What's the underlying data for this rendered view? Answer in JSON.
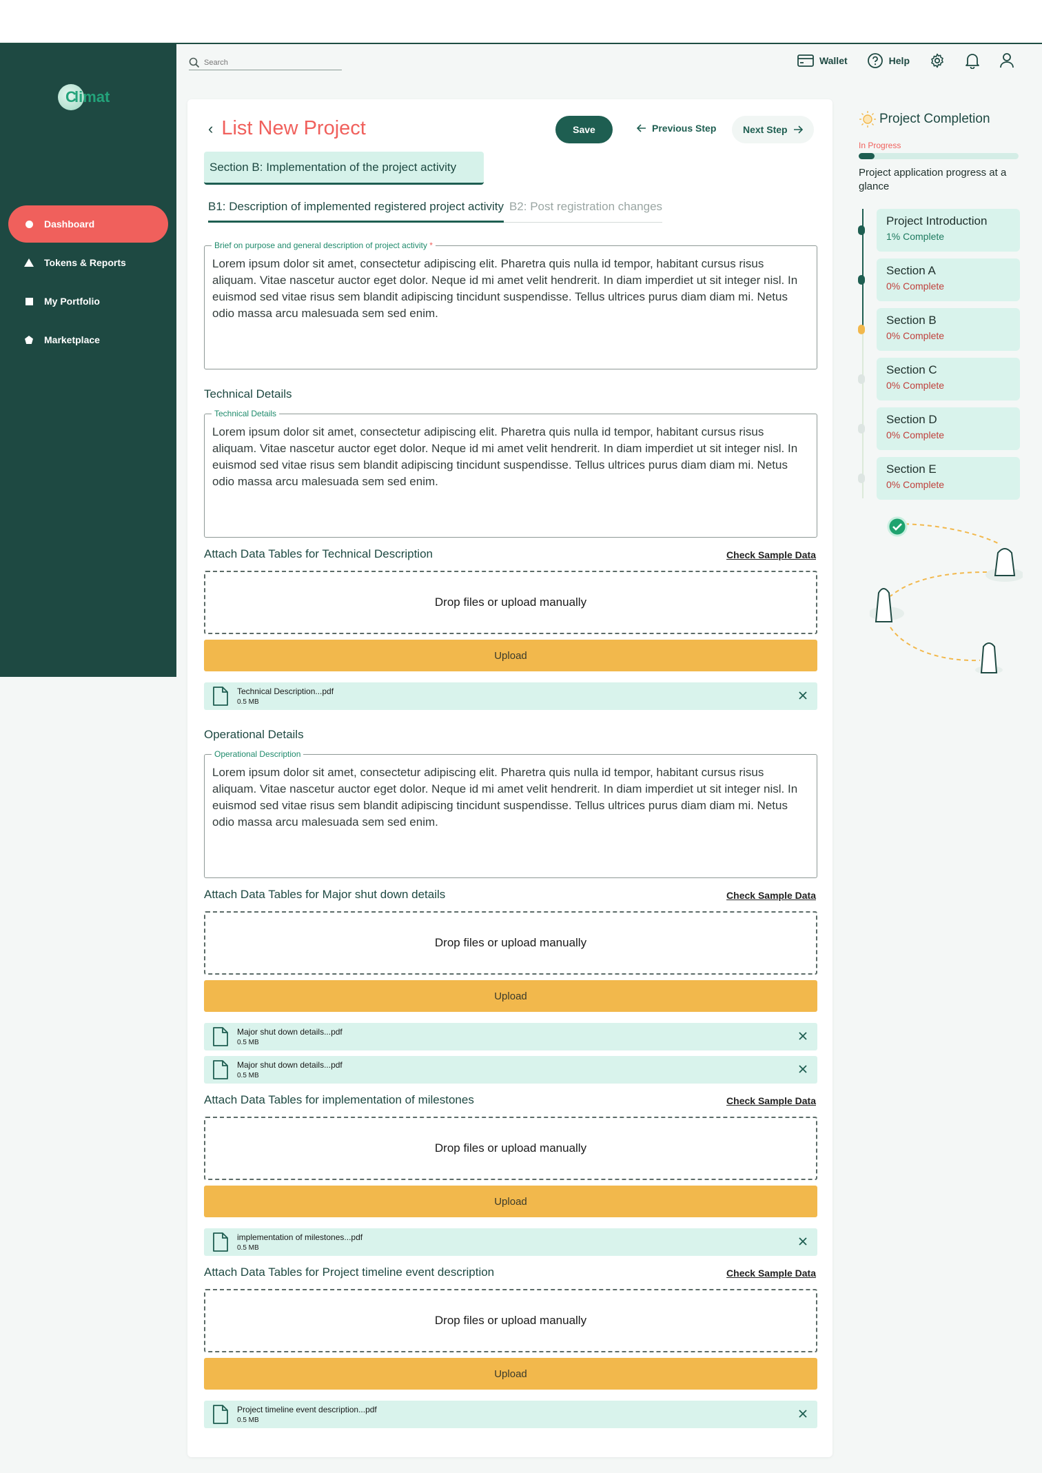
{
  "app": {
    "logo_letter": "C",
    "logo_text": "limat"
  },
  "sidebar": {
    "items": [
      {
        "label": "Dashboard",
        "icon": "circle-icon"
      },
      {
        "label": "Tokens & Reports",
        "icon": "triangle-icon"
      },
      {
        "label": "My Portfolio",
        "icon": "square-icon"
      },
      {
        "label": "Marketplace",
        "icon": "pentagon-icon"
      }
    ]
  },
  "topbar": {
    "search_placeholder": "Search",
    "wallet": "Wallet",
    "help": "Help"
  },
  "page": {
    "title": "List New Project",
    "save": "Save",
    "previous": "Previous Step",
    "next": "Next Step",
    "section": "Section B: Implementation of the project activity",
    "tabs": [
      "B1: Description of implemented registered project activity",
      "B2: Post registration changes"
    ]
  },
  "brief": {
    "legend": "Brief on purpose and general description of project activity",
    "required_mark": "*",
    "text": "Lorem ipsum dolor sit amet, consectetur adipiscing elit. Pharetra quis nulla id tempor, habitant cursus risus aliquam. Vitae nascetur auctor eget dolor. Neque id mi amet velit hendrerit. In diam imperdiet ut sit integer nisl. In euismod sed vitae risus sem blandit adipiscing tincidunt suspendisse. Tellus ultrices purus diam diam mi. Netus odio massa arcu malesuada sem sed enim."
  },
  "technical": {
    "heading": "Technical Details",
    "legend": "Technical Details",
    "text": "Lorem ipsum dolor sit amet, consectetur adipiscing elit. Pharetra quis nulla id tempor, habitant cursus risus aliquam. Vitae nascetur auctor eget dolor. Neque id mi amet velit hendrerit. In diam imperdiet ut sit integer nisl. In euismod sed vitae risus sem blandit adipiscing tincidunt suspendisse. Tellus ultrices purus diam diam mi. Netus odio massa arcu malesuada sem sed enim."
  },
  "operational": {
    "heading": "Operational Details",
    "legend": "Operational Description",
    "text": "Lorem ipsum dolor sit amet, consectetur adipiscing elit. Pharetra quis nulla id tempor, habitant cursus risus aliquam. Vitae nascetur auctor eget dolor. Neque id mi amet velit hendrerit. In diam imperdiet ut sit integer nisl. In euismod sed vitae risus sem blandit adipiscing tincidunt suspendisse. Tellus ultrices purus diam diam mi. Netus odio massa arcu malesuada sem sed enim."
  },
  "common": {
    "check_sample": "Check Sample Data",
    "drop": "Drop files or upload manually",
    "upload": "Upload"
  },
  "attachments": [
    {
      "heading": "Attach Data Tables for Technical Description",
      "files": [
        {
          "name": "Technical Description...pdf",
          "size": "0.5 MB"
        }
      ]
    },
    {
      "heading": "Attach Data Tables for  Major shut down details",
      "files": [
        {
          "name": "Major shut down details...pdf",
          "size": "0.5 MB"
        },
        {
          "name": "Major shut down details...pdf",
          "size": "0.5 MB"
        }
      ]
    },
    {
      "heading": "Attach Data Tables for  implementation of milestones",
      "files": [
        {
          "name": "implementation of milestones...pdf",
          "size": "0.5 MB"
        }
      ]
    },
    {
      "heading": "Attach Data Tables for  Project timeline event description",
      "files": [
        {
          "name": "Project timeline event description...pdf",
          "size": "0.5 MB"
        }
      ]
    }
  ],
  "progress": {
    "title": "Project Completion",
    "status": "In Progress",
    "fraction": 0.1,
    "description": "Project application progress at a glance",
    "steps": [
      {
        "title": "Project Introduction",
        "progress": "1% Complete",
        "state": "done"
      },
      {
        "title": "Section A",
        "progress": "0% Complete",
        "state": "done"
      },
      {
        "title": "Section B",
        "progress": "0% Complete",
        "state": "current"
      },
      {
        "title": "Section C",
        "progress": "0% Complete",
        "state": "todo"
      },
      {
        "title": "Section D",
        "progress": "0% Complete",
        "state": "todo"
      },
      {
        "title": "Section E",
        "progress": "0% Complete",
        "state": "todo"
      }
    ]
  },
  "colors": {
    "sidebar": "#1e4942",
    "accent": "#f0605c",
    "primary": "#1e5e51",
    "upload": "#f2b84c",
    "file_bg": "#d9f3ec"
  }
}
